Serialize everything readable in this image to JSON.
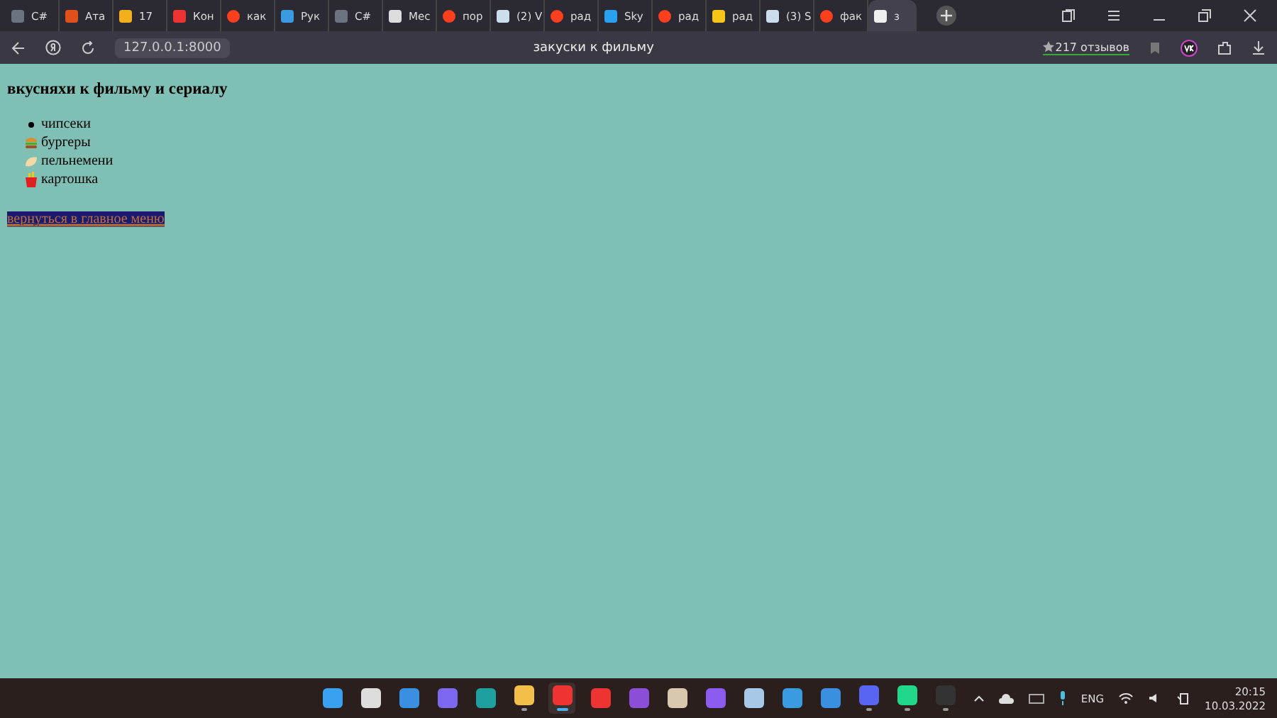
{
  "browser": {
    "tabs": [
      {
        "label": "C#",
        "kind": "doc",
        "selected": false
      },
      {
        "label": "Ата",
        "kind": "film",
        "selected": false
      },
      {
        "label": "17",
        "kind": "mail",
        "selected": false
      },
      {
        "label": "Кон",
        "kind": "app",
        "selected": false
      },
      {
        "label": "как",
        "kind": "yandex",
        "selected": false
      },
      {
        "label": "Рук",
        "kind": "windows",
        "selected": false
      },
      {
        "label": "C#",
        "kind": "doc",
        "selected": false
      },
      {
        "label": "Мес",
        "kind": "chat",
        "selected": false
      },
      {
        "label": "пор",
        "kind": "yandex",
        "selected": false
      },
      {
        "label": "(2) V",
        "kind": "bolt",
        "selected": false
      },
      {
        "label": "рад",
        "kind": "yandex",
        "selected": false
      },
      {
        "label": "Sky",
        "kind": "play",
        "selected": false
      },
      {
        "label": "рад",
        "kind": "yandex",
        "selected": false
      },
      {
        "label": "рад",
        "kind": "image",
        "selected": false
      },
      {
        "label": "(3) S",
        "kind": "bolt",
        "selected": false
      },
      {
        "label": "фак",
        "kind": "yandex",
        "selected": false
      },
      {
        "label": "з",
        "kind": "page",
        "selected": true
      }
    ],
    "address": "127.0.0.1:8000",
    "page_title": "закуски к фильму",
    "reviews": "217 отзывов"
  },
  "page": {
    "heading": "вкусняхи к фильму и сериалу",
    "items": [
      {
        "text": "чипсеки",
        "kind": "bullet"
      },
      {
        "text": "бургеры",
        "kind": "burger"
      },
      {
        "text": "пельнемени",
        "kind": "dumpling"
      },
      {
        "text": "картошка",
        "kind": "fries"
      }
    ],
    "link": "вернуться в главное меню"
  },
  "taskbar": {
    "apps": [
      {
        "kind": "start",
        "open": false,
        "selected": false
      },
      {
        "kind": "search",
        "open": false,
        "selected": false
      },
      {
        "kind": "widgets",
        "open": false,
        "selected": false
      },
      {
        "kind": "meet",
        "open": false,
        "selected": false
      },
      {
        "kind": "edge",
        "open": false,
        "selected": false
      },
      {
        "kind": "folder",
        "open": true,
        "selected": false
      },
      {
        "kind": "browser",
        "open": true,
        "selected": true
      },
      {
        "kind": "yandex",
        "open": false,
        "selected": false
      },
      {
        "kind": "studio",
        "open": false,
        "selected": false
      },
      {
        "kind": "picture",
        "open": false,
        "selected": false
      },
      {
        "kind": "alice",
        "open": false,
        "selected": false
      },
      {
        "kind": "chart",
        "open": false,
        "selected": false
      },
      {
        "kind": "phone",
        "open": false,
        "selected": false
      },
      {
        "kind": "window",
        "open": false,
        "selected": false
      },
      {
        "kind": "discord",
        "open": true,
        "selected": false
      },
      {
        "kind": "pycharm",
        "open": true,
        "selected": false
      },
      {
        "kind": "terminal",
        "open": true,
        "selected": false
      }
    ],
    "language": "ENG",
    "time": "20:15",
    "date": "10.03.2022"
  }
}
